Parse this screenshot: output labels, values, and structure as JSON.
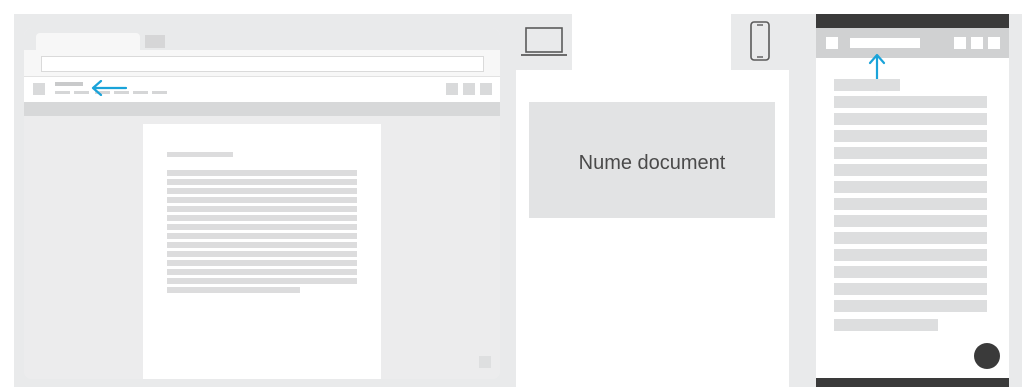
{
  "center_card": {
    "title": "Nume document"
  },
  "icons": {
    "desktop": "laptop-icon",
    "mobile": "phone-icon",
    "arrow_left": "arrow-left-icon",
    "arrow_up": "arrow-up-icon"
  },
  "colors": {
    "accent_arrow": "#1aa3d9",
    "background_gray": "#e9eaeb",
    "dark_bar": "#3a3a3a"
  }
}
